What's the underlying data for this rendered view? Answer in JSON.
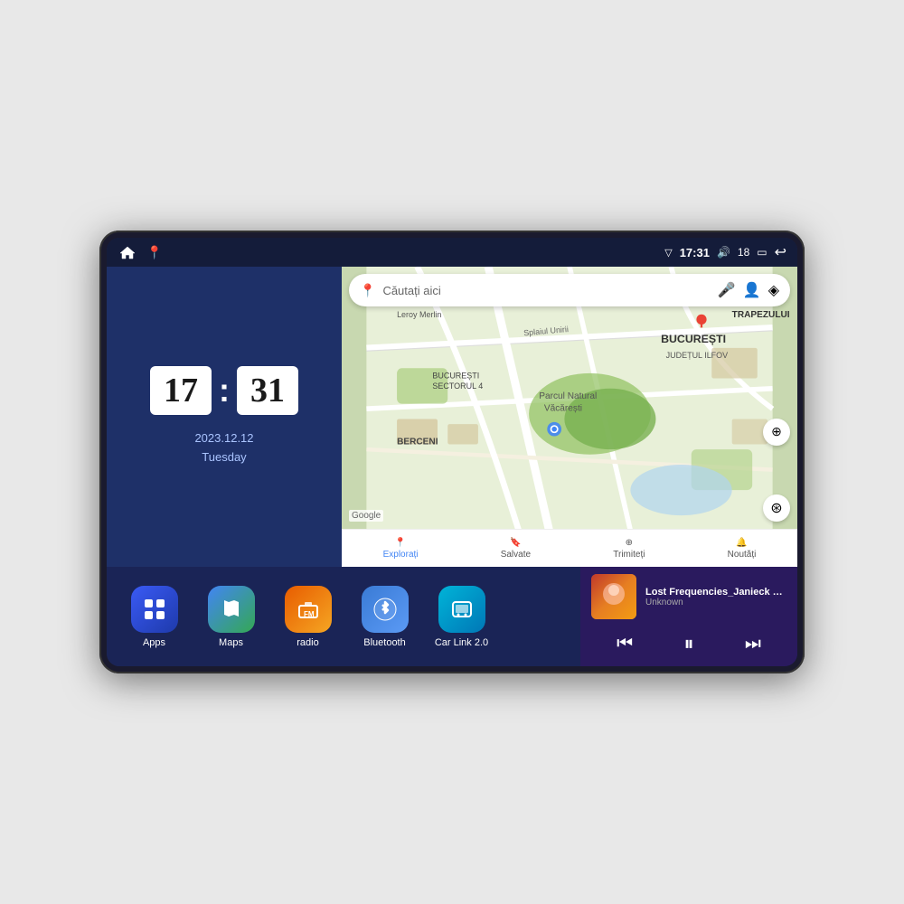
{
  "device": {
    "status_bar": {
      "time": "17:31",
      "signal_icon": "▽",
      "volume_icon": "🔊",
      "battery_level": "18",
      "battery_icon": "▭",
      "back_icon": "↩",
      "home_icon": "⌂",
      "maps_shortcut_icon": "📍"
    },
    "clock_widget": {
      "hours": "17",
      "minutes": "31",
      "date_line1": "2023.12.12",
      "date_line2": "Tuesday"
    },
    "map_widget": {
      "search_placeholder": "Căutați aici",
      "mic_icon": "🎤",
      "account_icon": "👤",
      "layers_icon": "◈",
      "google_logo": "Google",
      "bottom_items": [
        {
          "label": "Explorați",
          "icon": "📍"
        },
        {
          "label": "Salvate",
          "icon": "🔖"
        },
        {
          "label": "Trimiteți",
          "icon": "⊕"
        },
        {
          "label": "Noutăți",
          "icon": "🔔"
        }
      ],
      "location_name": "Parcul Natural Văcărești",
      "area_name": "BUCUREȘTI",
      "sub_area": "JUDEȚUL ILFOV",
      "district": "BUCUREȘTI SECTORUL 4",
      "street": "Leroy Merlin",
      "neighborhood": "BERCENI",
      "trapezului": "TRAPEZULUI"
    },
    "apps": [
      {
        "id": "apps",
        "label": "Apps",
        "icon": "⊞",
        "bg_class": "apps-icon-bg"
      },
      {
        "id": "maps",
        "label": "Maps",
        "icon": "🗺",
        "bg_class": "maps-icon-bg"
      },
      {
        "id": "radio",
        "label": "radio",
        "icon": "📻",
        "bg_class": "radio-icon-bg"
      },
      {
        "id": "bluetooth",
        "label": "Bluetooth",
        "icon": "ϐ",
        "bg_class": "bluetooth-icon-bg"
      },
      {
        "id": "carlink",
        "label": "Car Link 2.0",
        "icon": "🔗",
        "bg_class": "carlink-icon-bg"
      }
    ],
    "media": {
      "title": "Lost Frequencies_Janieck Devy-...",
      "artist": "Unknown",
      "prev_icon": "⏮",
      "play_icon": "⏸",
      "next_icon": "⏭"
    }
  }
}
